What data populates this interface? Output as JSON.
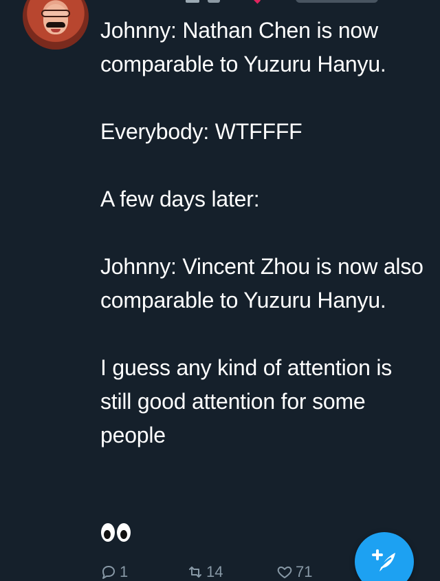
{
  "tweet": {
    "text": "Johnny: Nathan Chen is now comparable to Yuzuru Hanyu.\n\nEverybody: WTFFFF\n\nA few days later:\n\nJohnny: Vincent Zhou is now also comparable to Yuzuru Hanyu.\n\nI guess any kind of attention is still good attention for some people",
    "emoji": "eyes"
  },
  "actions": {
    "reply_count": "1",
    "retweet_count": "14",
    "like_count": "71"
  },
  "icons": {
    "reply": "reply-icon",
    "retweet": "retweet-icon",
    "like": "heart-icon",
    "compose": "compose-tweet-icon",
    "emoji": "eyes-emoji-icon"
  },
  "colors": {
    "background": "#15202b",
    "text": "#ffffff",
    "muted": "#8899a6",
    "accent": "#1da1f2"
  }
}
